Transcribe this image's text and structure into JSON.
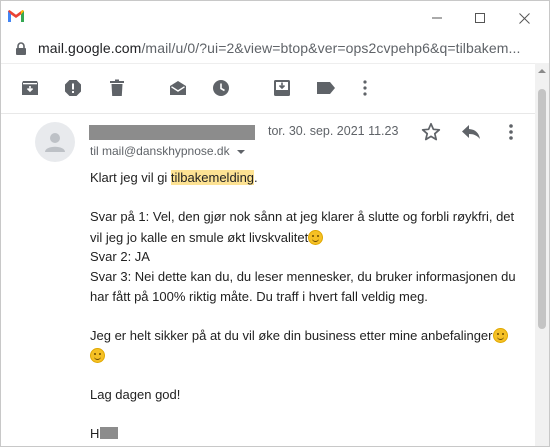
{
  "window": {
    "app_icon": "gmail-icon",
    "controls": {
      "minimize": "minimize-icon",
      "maximize": "maximize-icon",
      "close": "close-icon"
    }
  },
  "address": {
    "host": "mail.google.com",
    "path": "/mail/u/0/?ui=2&view=btop&ver=ops2cvpehp6&q=tilbakem..."
  },
  "toolbar": {
    "icons": [
      "archive-icon",
      "report-spam-icon",
      "delete-icon",
      "mark-unread-icon",
      "snooze-icon",
      "move-to-icon",
      "label-icon",
      "more-vert-icon"
    ]
  },
  "message": {
    "date": "tor. 30. sep. 2021 11.23",
    "to": "til mail@danskhypnose.dk",
    "body": {
      "line1_before": "Klart jeg vil gi ",
      "line1_highlight": "tilbakemelding",
      "line1_after": ".",
      "ans1_a": "Svar på 1: Vel, den gjør nok sånn at jeg klarer å slutte og forbli røykfri, det",
      "ans1_b": "vil jeg jo kalle en smule økt livskvalitet",
      "ans2": "Svar 2: JA",
      "ans3_a": "Svar 3: Nei dette kan du, du leser mennesker, du bruker informasjonen du",
      "ans3_b": "har fått på 100% riktig måte. Du traff i hvert fall veldig meg.",
      "closing_a": "Jeg er helt sikker på at du vil øke din business etter mine anbefalinger",
      "greeting": "Lag dagen god!",
      "signature": "H"
    }
  },
  "colors": {
    "highlight": "#fde293",
    "redaction": "#8c8c8c"
  }
}
